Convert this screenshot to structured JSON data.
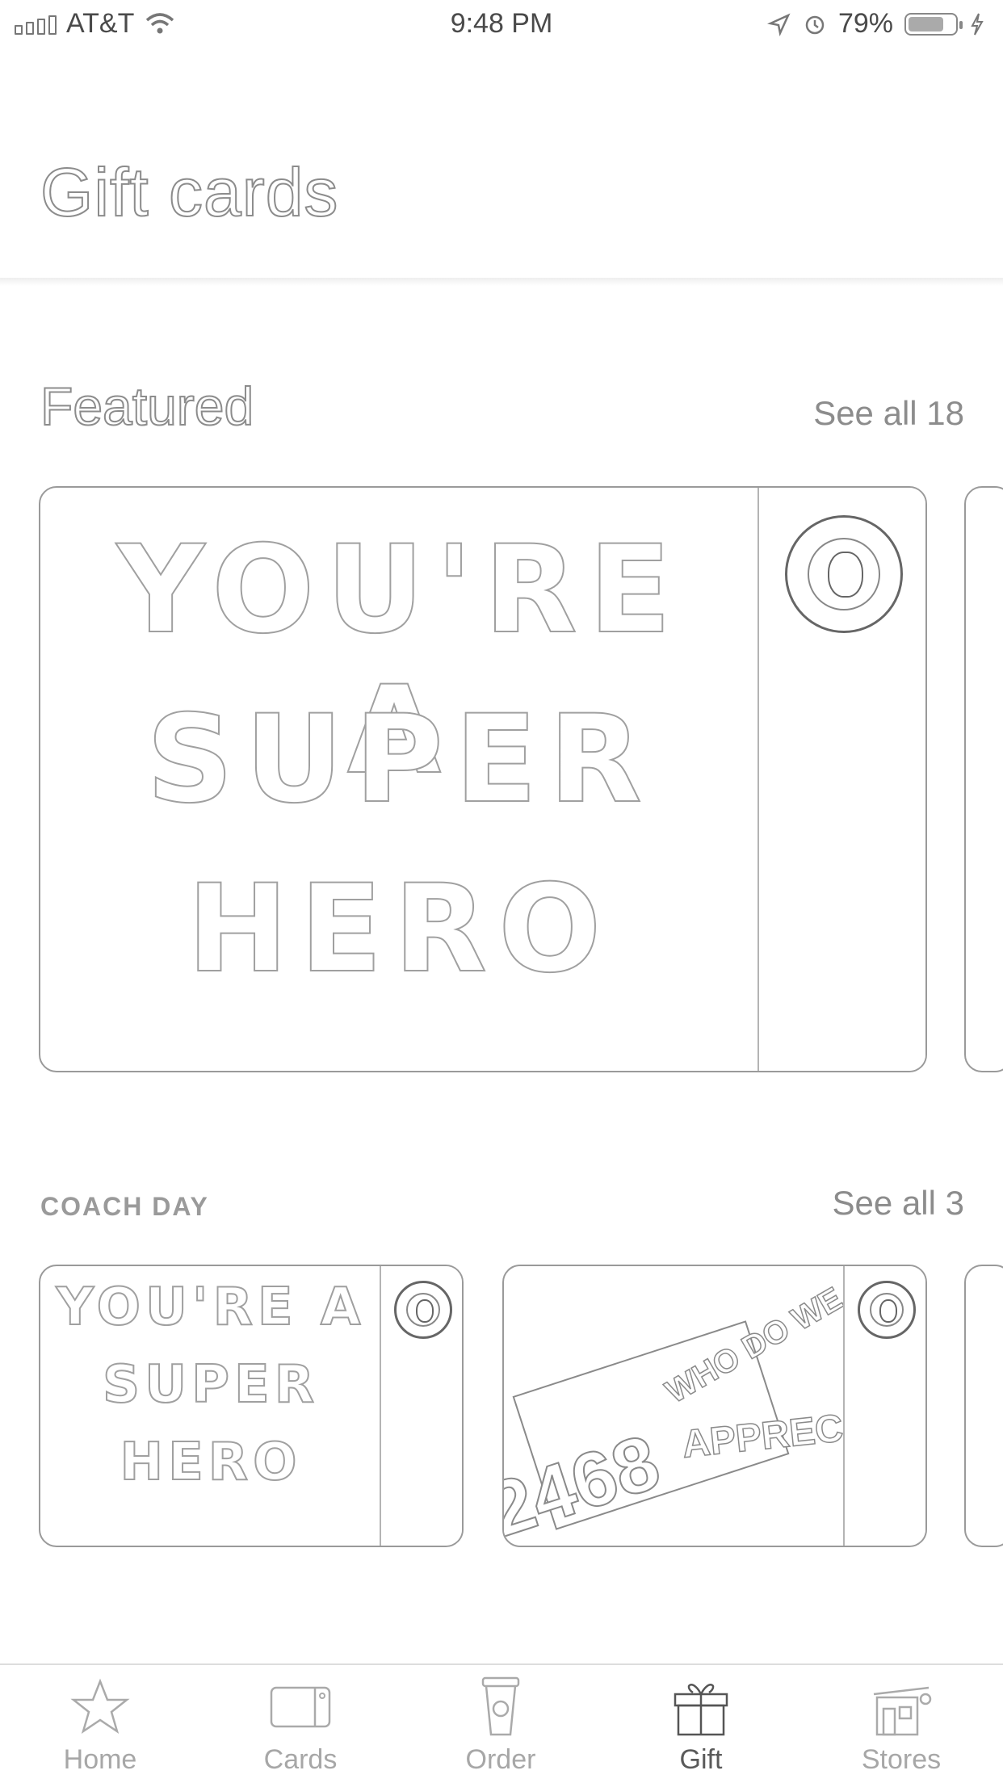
{
  "status_bar": {
    "carrier": "AT&T",
    "time": "9:48 PM",
    "battery": "79%",
    "battery_level": 0.79
  },
  "header": {
    "title": "Gift cards"
  },
  "featured": {
    "title": "Featured",
    "see_all": "See all 18",
    "card": {
      "line1": "YOU'RE A",
      "line2": "SUPER",
      "line3": "HERO"
    }
  },
  "coach_day": {
    "title": "COACH DAY",
    "see_all": "See all 3",
    "cards": [
      {
        "line1": "YOU'RE A",
        "line2": "SUPER",
        "line3": "HERO"
      },
      {
        "number": "2468",
        "top": "WHO DO WE",
        "bottom": "APPRECIATE"
      }
    ]
  },
  "tabs": [
    {
      "label": "Home",
      "icon": "star-icon"
    },
    {
      "label": "Cards",
      "icon": "card-icon"
    },
    {
      "label": "Order",
      "icon": "cup-icon"
    },
    {
      "label": "Gift",
      "icon": "gift-icon"
    },
    {
      "label": "Stores",
      "icon": "store-icon"
    }
  ],
  "active_tab": "Gift"
}
